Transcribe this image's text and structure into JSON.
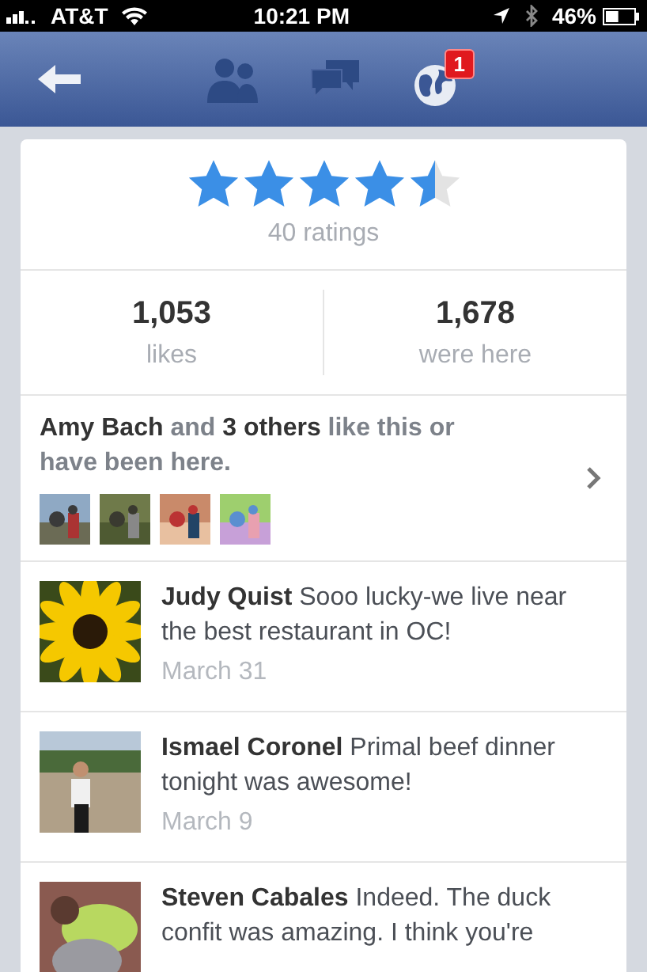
{
  "status_bar": {
    "carrier": "AT&T",
    "time": "10:21 PM",
    "battery": "46%"
  },
  "nav_bar": {
    "notification_badge": "1"
  },
  "rating": {
    "stars": 4.5,
    "count": "40 ratings"
  },
  "stats": [
    {
      "value": "1,053",
      "label": "likes"
    },
    {
      "value": "1,678",
      "label": "were here"
    }
  ],
  "friends": {
    "text": "**Amy Bach** and **3 others** like this or have been here."
  },
  "reviews": [
    {
      "text": "**Judy Quist** Sooo lucky-we live near the best restaurant in OC!",
      "date": "March 31"
    },
    {
      "text": "**Ismael Coronel** Primal beef dinner tonight was awesome!",
      "date": "March 9"
    },
    {
      "text": "**Steven Cabales** Indeed. The duck confit was amazing. I think you're"
    }
  ]
}
